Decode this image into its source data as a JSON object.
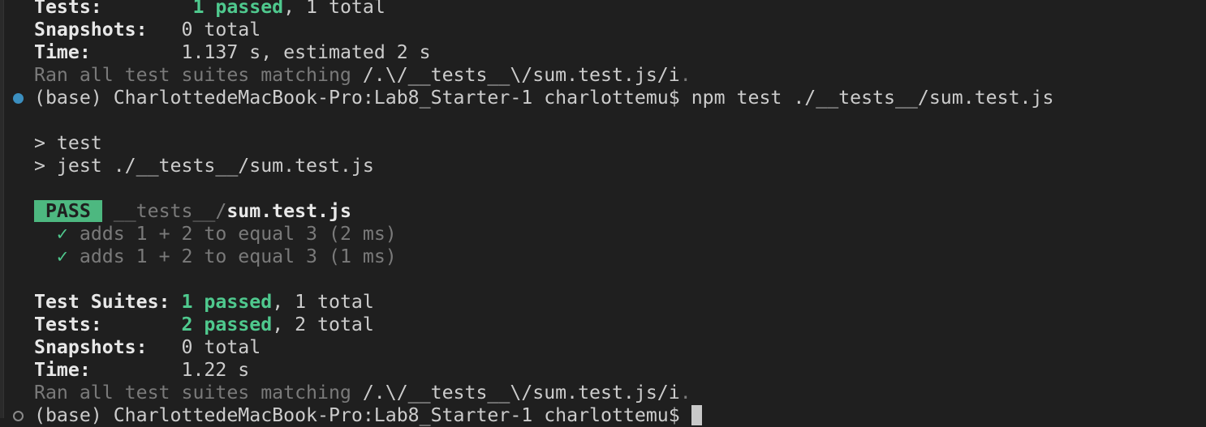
{
  "prev_run": {
    "tests_label": "Tests:",
    "tests_passed": "1 passed",
    "tests_total": ", 1 total",
    "snapshots_label": "Snapshots:",
    "snapshots_value": "0 total",
    "time_label": "Time:",
    "time_value": "1.137 s, estimated 2 s",
    "ran_text": "Ran all test suites matching ",
    "ran_pattern": "/.\\/__tests__\\/sum.test.js/i",
    "ran_end": "."
  },
  "command": {
    "prompt": "(base) CharlottedeMacBook-Pro:Lab8_Starter-1 charlottemu$ ",
    "text": "npm test ./__tests__/sum.test.js"
  },
  "script_lines": [
    "> test",
    "> jest ./__tests__/sum.test.js"
  ],
  "result": {
    "badge": " PASS ",
    "dir": "__tests__/",
    "file": "sum.test.js",
    "tests": [
      {
        "check": "✓",
        "text": "adds 1 + 2 to equal 3 (2 ms)"
      },
      {
        "check": "✓",
        "text": "adds 1 + 2 to equal 3 (1 ms)"
      }
    ]
  },
  "summary": {
    "suites_label": "Test Suites:",
    "suites_passed": "1 passed",
    "suites_total": ", 1 total",
    "tests_label": "Tests:",
    "tests_passed": "2 passed",
    "tests_total": ", 2 total",
    "snapshots_label": "Snapshots:",
    "snapshots_value": "0 total",
    "time_label": "Time:",
    "time_value": "1.22 s",
    "ran_text": "Ran all test suites matching ",
    "ran_pattern": "/.\\/__tests__\\/sum.test.js/i",
    "ran_end": "."
  },
  "final_prompt": "(base) CharlottedeMacBook-Pro:Lab8_Starter-1 charlottemu$ ",
  "colors": {
    "background": "#1f1f1f",
    "pass": "#4db880",
    "green": "#4fc98e",
    "dot": "#3b8fc0"
  }
}
